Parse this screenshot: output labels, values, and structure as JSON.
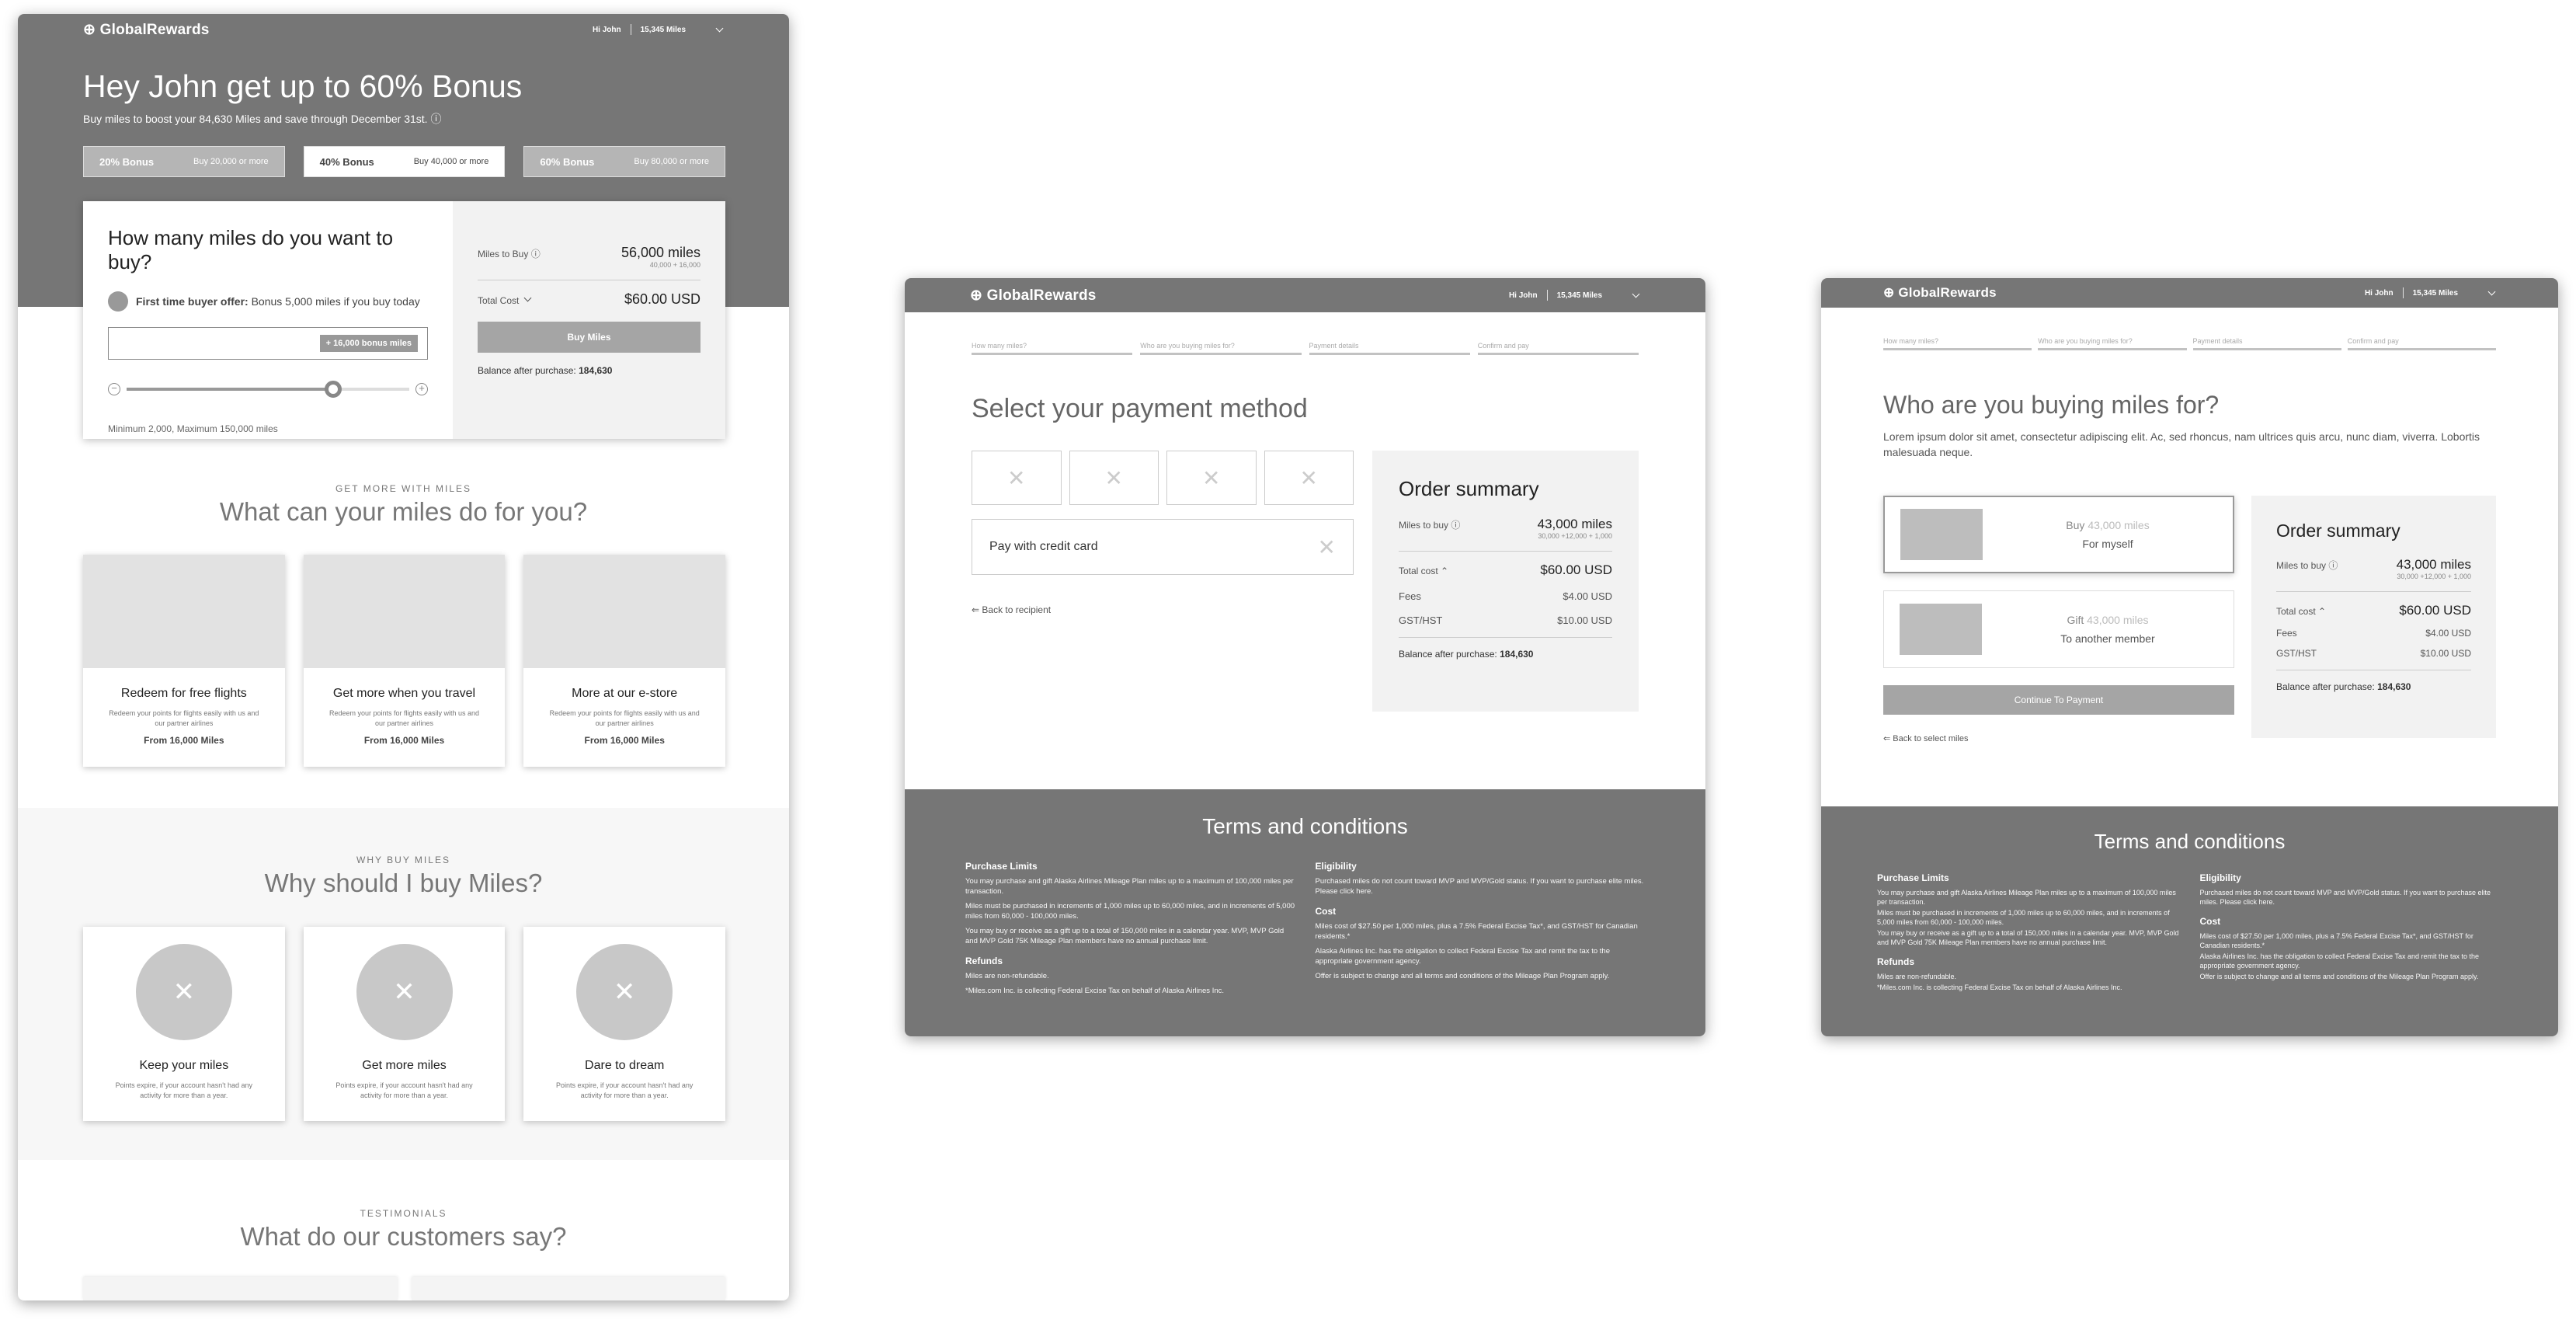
{
  "brand": "GlobalRewards",
  "user": {
    "greeting": "Hi John",
    "miles": "15,345 Miles"
  },
  "landing": {
    "title": "Hey John get up to 60% Bonus",
    "subtitle": "Buy miles to boost your 84,630 Miles and save through December 31st.",
    "bonuses": [
      {
        "label": "20% Bonus",
        "desc": "Buy 20,000 or more"
      },
      {
        "label": "40% Bonus",
        "desc": "Buy 40,000 or more"
      },
      {
        "label": "60% Bonus",
        "desc": "Buy 80,000 or more"
      }
    ],
    "selected_bonus_index": 1,
    "buy": {
      "question": "How many miles do you want to buy?",
      "first_time_label": "First time buyer offer:",
      "first_time_text": "Bonus 5,000 miles if you buy today",
      "bonus_chip": "+ 16,000 bonus miles",
      "slider_fraction": 0.73,
      "min_max": "Minimum 2,000, Maximum 150,000 miles",
      "miles_to_buy_label": "Miles to Buy",
      "miles_to_buy_value": "56,000 miles",
      "miles_breakdown": "40,000 + 16,000",
      "total_cost_label": "Total Cost",
      "total_cost_value": "$60.00 USD",
      "button": "Buy Miles",
      "balance_label": "Balance after purchase:",
      "balance_value": "184,630"
    },
    "section1": {
      "eyebrow": "GET MORE WITH MILES",
      "title": "What can your miles do for you?"
    },
    "offers": [
      {
        "title": "Redeem for free flights",
        "text": "Redeem your points for flights easily with us and our partner airlines",
        "from": "From 16,000 Miles"
      },
      {
        "title": "Get more when you travel",
        "text": "Redeem your points for flights easily with us and our partner airlines",
        "from": "From 16,000 Miles"
      },
      {
        "title": "More at our e-store",
        "text": "Redeem your points for flights easily with us and our partner airlines",
        "from": "From 16,000 Miles"
      }
    ],
    "section2": {
      "eyebrow": "WHY BUY MILES",
      "title": "Why should I buy Miles?"
    },
    "reasons": [
      {
        "title": "Keep your miles",
        "text": "Points expire, if your account hasn't had any activity for more than a year."
      },
      {
        "title": "Get more miles",
        "text": "Points expire, if your account hasn't had any activity for more than a year."
      },
      {
        "title": "Dare to dream",
        "text": "Points expire, if your account hasn't had any activity for more than a year."
      }
    ],
    "section3": {
      "eyebrow": "TESTIMONIALS",
      "title": "What do our customers say?"
    }
  },
  "steps": [
    "How many miles?",
    "Who are you buying miles for?",
    "Payment details",
    "Confirm and pay"
  ],
  "payment": {
    "title": "Select your payment method",
    "credit_card": "Pay with credit card",
    "back": "Back to recipient"
  },
  "recipient": {
    "title": "Who are you buying miles for?",
    "lorem": "Lorem ipsum dolor sit amet, consectetur adipiscing elit. Ac, sed rhoncus, nam ultrices quis arcu, nunc diam, viverra. Lobortis malesuada neque.",
    "options": [
      {
        "verb": "Buy",
        "miles": "43,000 miles",
        "sub": "For  myself"
      },
      {
        "verb": "Gift",
        "miles": "43,000 miles",
        "sub": "To another member"
      }
    ],
    "button": "Continue To Payment",
    "back": "Back to select miles"
  },
  "summary": {
    "title": "Order summary",
    "miles_label": "Miles to buy",
    "miles_value": "43,000 miles",
    "miles_breakdown": "30,000 +12,000 + 1,000",
    "total_label": "Total cost",
    "total_value": "$60.00 USD",
    "fees_label": "Fees",
    "fees_value": "$4.00 USD",
    "tax_label": "GST/HST",
    "tax_value": "$10.00 USD",
    "balance_label": "Balance after purchase:",
    "balance_value": "184,630"
  },
  "terms": {
    "title": "Terms and conditions",
    "purchase_title": "Purchase Limits",
    "purchase_text": "You may purchase and gift Alaska Airlines Mileage Plan miles up to a maximum of 100,000 miles per transaction.",
    "purchase_text2": "Miles must be purchased in increments of 1,000 miles up to 60,000 miles, and in increments of 5,000 miles from 60,000 - 100,000 miles.",
    "purchase_text3": "You may buy or receive as a gift up to a total of 150,000 miles in a calendar year. MVP, MVP Gold and MVP Gold 75K Mileage Plan members have no annual purchase limit.",
    "refunds_title": "Refunds",
    "refunds_text": "Miles are non-refundable.",
    "refunds_text2": "*Miles.com Inc. is collecting Federal Excise Tax on behalf of Alaska Airlines Inc.",
    "eligibility_title": "Eligibility",
    "eligibility_text": "Purchased miles do not count toward MVP and MVP/Gold status. If you want to purchase elite miles. Please click here.",
    "cost_title": "Cost",
    "cost_text": "Miles cost of $27.50 per 1,000 miles, plus a 7.5% Federal Excise Tax*, and GST/HST for Canadian residents.*",
    "cost_text2": "Alaska Airlines Inc. has the obligation to collect Federal Excise Tax and remit the tax to the appropriate government agency.",
    "cost_text3": "Offer is subject to change and all terms and conditions of the Mileage Plan Program apply."
  }
}
